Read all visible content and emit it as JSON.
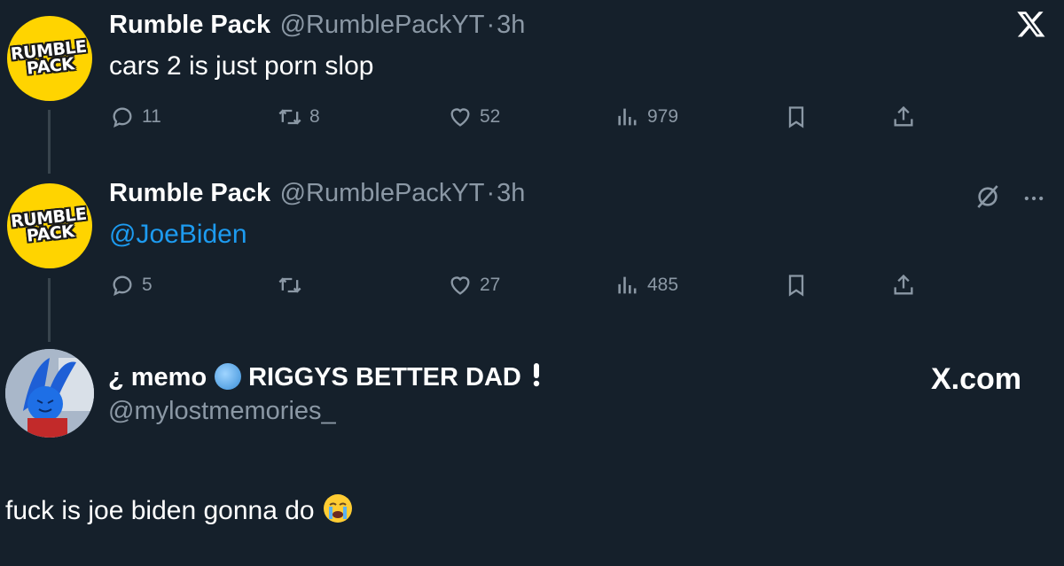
{
  "tweets": [
    {
      "name": "Rumble Pack",
      "handle": "@RumblePackYT",
      "sep": "·",
      "time": "3h",
      "text": "cars 2 is just porn slop",
      "avatar_text": [
        "RUMBLE",
        "PACK"
      ],
      "actions": {
        "replies": "11",
        "retweets": "8",
        "likes": "52",
        "views": "979"
      }
    },
    {
      "name": "Rumble Pack",
      "handle": "@RumblePackYT",
      "sep": "·",
      "time": "3h",
      "text": "@JoeBiden",
      "avatar_text": [
        "RUMBLE",
        "PACK"
      ],
      "actions": {
        "replies": "5",
        "retweets": "",
        "likes": "27",
        "views": "485"
      }
    }
  ],
  "quote": {
    "name_prefix": "¿ memo",
    "name_suffix": "RIGGYS BETTER DAD",
    "handle": "@mylostmemories_",
    "text": "fuck is joe biden gonna do",
    "brand": "X.com"
  },
  "colors": {
    "background": "#15202b",
    "muted": "#8b98a5",
    "link": "#1d9bf0",
    "avatar_yellow": "#ffd400"
  },
  "icons": [
    "x-logo-icon",
    "reply-icon",
    "retweet-icon",
    "like-icon",
    "views-icon",
    "bookmark-icon",
    "share-icon",
    "grok-icon",
    "more-icon",
    "globe-icon",
    "exclamation-icon",
    "loudly-crying-emoji"
  ]
}
